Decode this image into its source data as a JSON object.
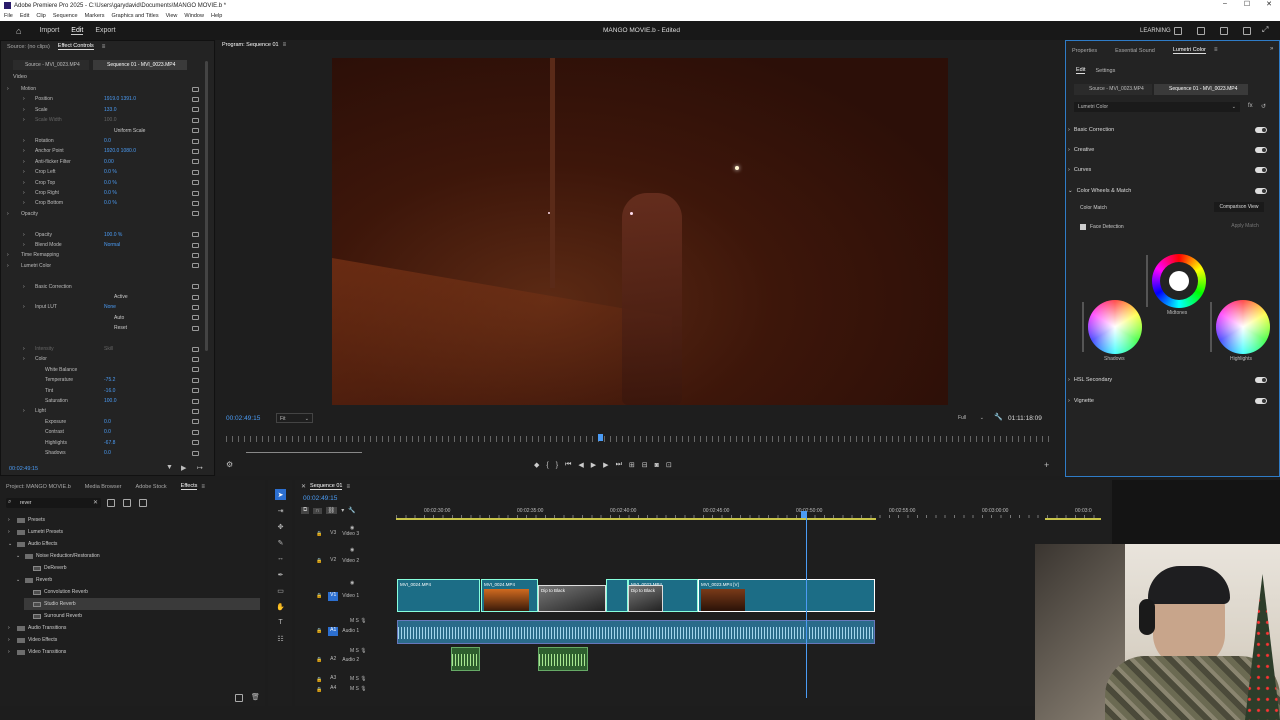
{
  "window": {
    "title": "Adobe Premiere Pro 2025 - C:\\Users\\garydavid\\Documents\\MANGO MOVIE.b *"
  },
  "menu": [
    "File",
    "Edit",
    "Clip",
    "Sequence",
    "Markers",
    "Graphics and Titles",
    "View",
    "Window",
    "Help"
  ],
  "app": {
    "workspaces": [
      "Import",
      "Edit",
      "Export"
    ],
    "project_title": "MANGO MOVIE.b - Edited",
    "learning": "LEARNING"
  },
  "effect_controls": {
    "tabs": [
      "Source: (no clips)",
      "Effect Controls"
    ],
    "source_tab": "Source - MVI_0023.MP4",
    "sequence_tab": "Sequence 01 - MVI_0023.MP4",
    "section": "Video",
    "rows": [
      {
        "name": "Motion",
        "value": "",
        "indent": 1
      },
      {
        "name": "Position",
        "value": "1919.0     1391.0",
        "indent": 2
      },
      {
        "name": "Scale",
        "value": "133.0",
        "indent": 2
      },
      {
        "name": "Scale Width",
        "value": "100.0",
        "indent": 2,
        "disabled": true
      },
      {
        "name": "",
        "value": "Uniform Scale",
        "indent": 3
      },
      {
        "name": "Rotation",
        "value": "0.0",
        "indent": 2
      },
      {
        "name": "Anchor Point",
        "value": "1920.0     1080.0",
        "indent": 2
      },
      {
        "name": "Anti-flicker Filter",
        "value": "0.00",
        "indent": 2
      },
      {
        "name": "Crop Left",
        "value": "0.0 %",
        "indent": 2
      },
      {
        "name": "Crop Top",
        "value": "0.0 %",
        "indent": 2
      },
      {
        "name": "Crop Right",
        "value": "0.0 %",
        "indent": 2
      },
      {
        "name": "Crop Bottom",
        "value": "0.0 %",
        "indent": 2
      },
      {
        "name": "Opacity",
        "value": "",
        "indent": 1
      },
      {
        "name": "",
        "value": "",
        "indent": 2
      },
      {
        "name": "Opacity",
        "value": "100.0 %",
        "indent": 2
      },
      {
        "name": "Blend Mode",
        "value": "Normal",
        "indent": 2
      },
      {
        "name": "Time Remapping",
        "value": "",
        "indent": 1
      },
      {
        "name": "Lumetri Color",
        "value": "",
        "indent": 1
      },
      {
        "name": "",
        "value": "",
        "indent": 2
      },
      {
        "name": "Basic Correction",
        "value": "",
        "indent": 2
      },
      {
        "name": "",
        "value": "Active",
        "indent": 3
      },
      {
        "name": "Input LUT",
        "value": "None",
        "indent": 2
      },
      {
        "name": "",
        "value": "Auto",
        "indent": 3
      },
      {
        "name": "",
        "value": "Reset",
        "indent": 3
      },
      {
        "name": "",
        "value": "",
        "indent": 2
      },
      {
        "name": "Intensity",
        "value": "Skill",
        "indent": 2,
        "disabled": true
      },
      {
        "name": "Color",
        "value": "",
        "indent": 2
      },
      {
        "name": "White Balance",
        "value": "",
        "indent": 3
      },
      {
        "name": "Temperature",
        "value": "-75.2",
        "indent": 3
      },
      {
        "name": "Tint",
        "value": "-16.0",
        "indent": 3
      },
      {
        "name": "Saturation",
        "value": "100.0",
        "indent": 3
      },
      {
        "name": "Light",
        "value": "",
        "indent": 2
      },
      {
        "name": "Exposure",
        "value": "0.0",
        "indent": 3
      },
      {
        "name": "Contrast",
        "value": "0.0",
        "indent": 3
      },
      {
        "name": "Highlights",
        "value": "-67.8",
        "indent": 3
      },
      {
        "name": "Shadows",
        "value": "0.0",
        "indent": 3
      }
    ],
    "timecode": "00:02:49:15"
  },
  "program": {
    "tab": "Program: Sequence 01",
    "timecode": "00:02:49:15",
    "fit": "Fit",
    "quality": "Full",
    "duration": "01:11:18:09"
  },
  "lumetri": {
    "tabs": [
      "Properties",
      "Essential Sound",
      "Lumetri Color"
    ],
    "subtabs": [
      "Edit",
      "Settings"
    ],
    "source_tab": "Source - MVI_0023.MP4",
    "sequence_tab": "Sequence 01 - MVI_0023.MP4",
    "effect": "Lumetri Color",
    "sections_top": [
      "Basic Correction",
      "Creative",
      "Curves",
      "Color Wheels & Match"
    ],
    "color_match": "Color Match",
    "comparison_view": "Comparison View",
    "face_detection": "Face Detection",
    "apply_match": "Apply Match",
    "wheels": [
      "Midtones",
      "Shadows",
      "Highlights"
    ],
    "sections_bottom": [
      "HSL Secondary",
      "Vignette"
    ]
  },
  "project": {
    "tabs": [
      "Project: MANGO MOVIE.b",
      "Media Browser",
      "Adobe Stock",
      "Effects"
    ],
    "search": "rever",
    "items": [
      {
        "label": "Presets",
        "depth": 0,
        "type": "folder"
      },
      {
        "label": "Lumetri Presets",
        "depth": 0,
        "type": "folder"
      },
      {
        "label": "Audio Effects",
        "depth": 0,
        "type": "folder",
        "open": true
      },
      {
        "label": "Noise Reduction/Restoration",
        "depth": 1,
        "type": "folder",
        "open": true
      },
      {
        "label": "DeReverb",
        "depth": 2,
        "type": "fx"
      },
      {
        "label": "Reverb",
        "depth": 1,
        "type": "folder",
        "open": true
      },
      {
        "label": "Convolution Reverb",
        "depth": 2,
        "type": "fx"
      },
      {
        "label": "Studio Reverb",
        "depth": 2,
        "type": "fx",
        "selected": true
      },
      {
        "label": "Surround Reverb",
        "depth": 2,
        "type": "fx"
      },
      {
        "label": "Audio Transitions",
        "depth": 0,
        "type": "folder"
      },
      {
        "label": "Video Effects",
        "depth": 0,
        "type": "folder"
      },
      {
        "label": "Video Transitions",
        "depth": 0,
        "type": "folder"
      }
    ]
  },
  "timeline": {
    "tab": "Sequence 01",
    "timecode": "00:02:49:15",
    "ruler": [
      "00:02:30:00",
      "00:02:35:00",
      "00:02:40:00",
      "00:02:45:00",
      "00:02:50:00",
      "00:02:55:00",
      "00:03:00:00",
      "00:03:0"
    ],
    "tracks": [
      {
        "id": "V3",
        "name": "Video 3"
      },
      {
        "id": "V2",
        "name": "Video 2"
      },
      {
        "id": "V1",
        "name": "Video 1"
      },
      {
        "id": "A1",
        "name": "Audio 1"
      },
      {
        "id": "A2",
        "name": "Audio 2"
      },
      {
        "id": "A3",
        "name": ""
      },
      {
        "id": "A4",
        "name": ""
      }
    ],
    "video_clips": [
      "MVI_0024.MP4",
      "MVI_0024.MP4",
      "Dip to Black",
      "MVI_0023.MP4",
      "Dip to Black",
      "MVI_0023.MP4 [V]"
    ]
  },
  "colors": {
    "accent": "#4b9cf5",
    "playhead": "#4b9cf5",
    "clip_video": "#1c6d86",
    "clip_audio": "#2a6b8a",
    "clip_green": "#2e5f2e"
  }
}
